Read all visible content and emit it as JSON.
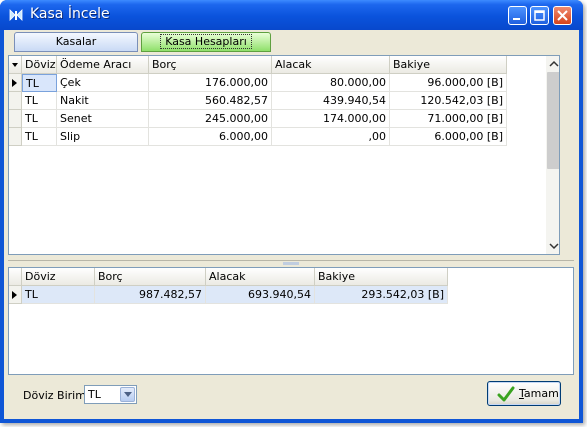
{
  "window": {
    "title": "Kasa İncele"
  },
  "tabs": [
    {
      "label": "Kasalar",
      "active": false
    },
    {
      "label": "Kasa Hesapları",
      "active": true
    }
  ],
  "accounts_grid": {
    "columns": [
      "Döviz",
      "Ödeme Aracı",
      "Borç",
      "Alacak",
      "Bakiye"
    ],
    "rows": [
      {
        "currency": "TL",
        "method": "Çek",
        "debit": "176.000,00",
        "credit": "80.000,00",
        "balance": "96.000,00 [B]",
        "current": true
      },
      {
        "currency": "TL",
        "method": "Nakit",
        "debit": "560.482,57",
        "credit": "439.940,54",
        "balance": "120.542,03 [B]",
        "current": false
      },
      {
        "currency": "TL",
        "method": "Senet",
        "debit": "245.000,00",
        "credit": "174.000,00",
        "balance": "71.000,00 [B]",
        "current": false
      },
      {
        "currency": "TL",
        "method": "Slip",
        "debit": "6.000,00",
        "credit": ",00",
        "balance": "6.000,00 [B]",
        "current": false
      }
    ]
  },
  "totals_grid": {
    "columns": [
      "Döviz",
      "Borç",
      "Alacak",
      "Bakiye"
    ],
    "rows": [
      {
        "currency": "TL",
        "debit": "987.482,57",
        "credit": "693.940,54",
        "balance": "293.542,03 [B]"
      }
    ]
  },
  "footer": {
    "currency_label": "Döviz Birimi",
    "currency_value": "TL",
    "ok_label_accel": "T",
    "ok_label_rest": "amam"
  },
  "colors": {
    "title_bar": "#0a53dc",
    "active_tab": "#8fe06a",
    "selected_row": "#dde8f8"
  },
  "icons": [
    "app-icon",
    "minimize-icon",
    "maximize-icon",
    "close-icon",
    "chevron-down-icon",
    "check-icon",
    "row-pointer-icon"
  ]
}
